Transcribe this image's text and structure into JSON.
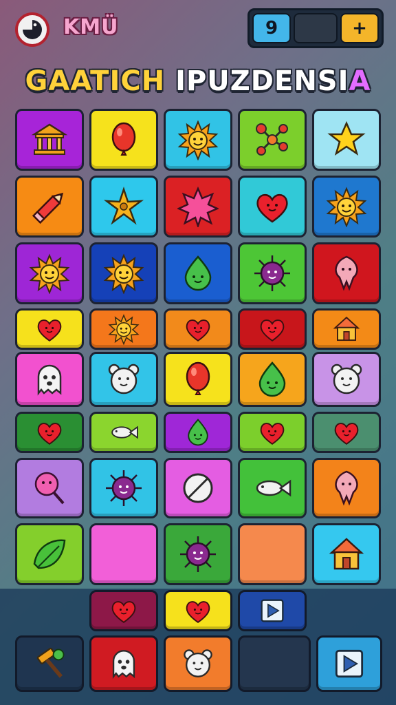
{
  "header": {
    "logo_text": "KMÜ",
    "title_part1": "GAATICH",
    "title_part2": "IPUZDENSI",
    "title_tail": "A",
    "controls": [
      {
        "label": "9",
        "icon": "swirl-icon",
        "color": "#43b6ea"
      },
      {
        "label": "",
        "icon": "empty-slot",
        "color": "#2d3847"
      },
      {
        "label": "+",
        "icon": "plus-icon",
        "color": "#f4b52a"
      }
    ]
  },
  "board": {
    "rows": [
      [
        {
          "icon": "temple-icon",
          "color": "#a724d8"
        },
        {
          "icon": "balloon-icon",
          "color": "#f6e21c"
        },
        {
          "icon": "sun-icon",
          "color": "#31c3e6"
        },
        {
          "icon": "molecule-icon",
          "color": "#7ccf2c"
        },
        {
          "icon": "star-icon",
          "color": "#9fe4f3"
        }
      ],
      [
        {
          "icon": "pencil-icon",
          "color": "#f68b14"
        },
        {
          "icon": "starfish-icon",
          "color": "#2ec8ec"
        },
        {
          "icon": "burst-icon",
          "color": "#db2124"
        },
        {
          "icon": "heart-icon",
          "color": "#31c9d7"
        },
        {
          "icon": "sun-icon",
          "color": "#1f78cf"
        }
      ],
      [
        {
          "icon": "sun-icon",
          "color": "#9e26d6"
        },
        {
          "icon": "sun-icon",
          "color": "#1541b8"
        },
        {
          "icon": "drop-face-icon",
          "color": "#1a5ed0"
        },
        {
          "icon": "urchin-icon",
          "color": "#4dc636"
        },
        {
          "icon": "squid-icon",
          "color": "#d0161e"
        }
      ],
      [
        {
          "icon": "heart-icon",
          "color": "#f6e11c"
        },
        {
          "icon": "sun-icon",
          "color": "#f4771b"
        },
        {
          "icon": "heart-icon",
          "color": "#f28a1b"
        },
        {
          "icon": "heart-icon",
          "color": "#c8161b"
        },
        {
          "icon": "house-icon",
          "color": "#f38a17"
        }
      ],
      [
        {
          "icon": "ghost-icon",
          "color": "#f251cf"
        },
        {
          "icon": "bear-icon",
          "color": "#32c4e8"
        },
        {
          "icon": "balloon-icon",
          "color": "#f6e21c"
        },
        {
          "icon": "drop-face-icon",
          "color": "#f6a51c"
        },
        {
          "icon": "bear-icon",
          "color": "#c893e7"
        }
      ],
      [
        {
          "icon": "heart-icon",
          "color": "#2a8f33"
        },
        {
          "icon": "fish-icon",
          "color": "#8bd52e"
        },
        {
          "icon": "drop-face-icon",
          "color": "#9f27d7"
        },
        {
          "icon": "heart-icon",
          "color": "#7ccf2c"
        },
        {
          "icon": "heart-icon",
          "color": "#4b8f6f"
        }
      ],
      [
        {
          "icon": "lollipop-icon",
          "color": "#b27ce0"
        },
        {
          "icon": "urchin-icon",
          "color": "#31c3e6"
        },
        {
          "icon": "no-sign-icon",
          "color": "#e45de2"
        },
        {
          "icon": "fish-icon",
          "color": "#43c13a"
        },
        {
          "icon": "squid-icon",
          "color": "#f3831a"
        }
      ],
      [
        {
          "icon": "leaf-icon",
          "color": "#84cf2c"
        },
        {
          "icon": "empty-tile",
          "color": "#f25fd8"
        },
        {
          "icon": "urchin-icon",
          "color": "#3aa83a"
        },
        {
          "icon": "empty-tile",
          "color": "#f5894d"
        },
        {
          "icon": "house-icon",
          "color": "#35c8ef"
        }
      ]
    ]
  },
  "tray": {
    "row1": [
      {
        "icon": "heart-icon",
        "color": "#8d1848"
      },
      {
        "icon": "heart-icon",
        "color": "#f6e11c"
      },
      {
        "icon": "play-icon",
        "color": "#1f49a8"
      }
    ],
    "row2": [
      {
        "icon": "hammer-icon",
        "color": "#1f3550"
      },
      {
        "icon": "ghost-icon",
        "color": "#d01b22"
      },
      {
        "icon": "bear-icon",
        "color": "#f27c2c"
      },
      {
        "icon": "empty-slot",
        "color": "#24364e"
      },
      {
        "icon": "play-icon",
        "color": "#2ea0da"
      }
    ]
  }
}
